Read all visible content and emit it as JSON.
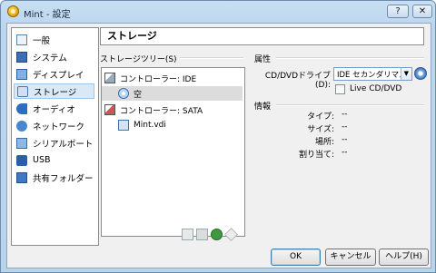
{
  "window": {
    "title": "Mint - 設定",
    "help": "?",
    "close": "✕"
  },
  "sidebar": {
    "items": [
      {
        "label": "一般",
        "icon": "general-icon"
      },
      {
        "label": "システム",
        "icon": "system-icon"
      },
      {
        "label": "ディスプレイ",
        "icon": "display-icon"
      },
      {
        "label": "ストレージ",
        "icon": "storage-icon",
        "selected": true
      },
      {
        "label": "オーディオ",
        "icon": "audio-icon"
      },
      {
        "label": "ネットワーク",
        "icon": "network-icon"
      },
      {
        "label": "シリアルポート",
        "icon": "serial-port-icon"
      },
      {
        "label": "USB",
        "icon": "usb-icon"
      },
      {
        "label": "共有フォルダー",
        "icon": "shared-folder-icon"
      }
    ]
  },
  "panel": {
    "title": "ストレージ"
  },
  "tree": {
    "label": "ストレージツリー(S)",
    "items": [
      {
        "label": "コントローラー: IDE",
        "icon": "ide-controller-icon"
      },
      {
        "label": "空",
        "icon": "cd-icon"
      },
      {
        "label": "コントローラー: SATA",
        "icon": "sata-controller-icon"
      },
      {
        "label": "Mint.vdi",
        "icon": "hard-disk-icon"
      }
    ]
  },
  "attributes": {
    "heading": "属性",
    "dvd_label": "CD/DVDドライブ(D):",
    "dvd_value": "IDE セカンダリマスター",
    "live_cd_label": "Live CD/DVD"
  },
  "info": {
    "heading": "情報",
    "rows": [
      {
        "label": "タイプ:",
        "value": "--"
      },
      {
        "label": "サイズ:",
        "value": "--"
      },
      {
        "label": "場所:",
        "value": "--"
      },
      {
        "label": "割り当て:",
        "value": "--"
      }
    ]
  },
  "buttons": {
    "ok": "OK",
    "cancel": "キャンセル",
    "help": "ヘルプ(H)"
  },
  "colors": {
    "selection": "#dbe9f7",
    "title_bar": "#c8dff2"
  }
}
